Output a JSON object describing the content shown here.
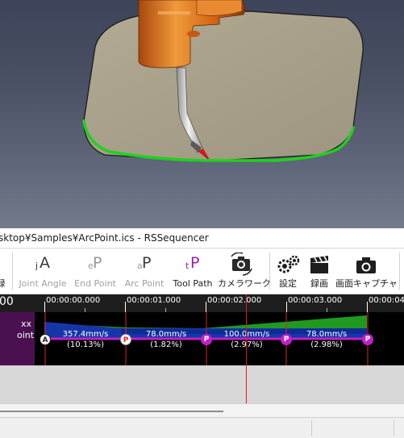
{
  "window": {
    "title": "sktop¥Samples¥ArcPoint.ics - RSSequencer"
  },
  "toolbar": {
    "left_cut_label": "録",
    "buttons": [
      {
        "id": "joint-angle",
        "prefix": "j",
        "glyph": "A",
        "label": "Joint Angle",
        "enabled": false,
        "icon": "joint-angle-icon"
      },
      {
        "id": "end-point",
        "prefix": "e",
        "glyph": "P",
        "label": "End Point",
        "enabled": false,
        "icon": "end-point-icon"
      },
      {
        "id": "arc-point",
        "prefix": "a",
        "glyph": "P",
        "label": "Arc Point",
        "enabled": false,
        "icon": "arc-point-icon"
      },
      {
        "id": "tool-path",
        "prefix": "t",
        "glyph": "P",
        "label": "Tool Path",
        "enabled": true,
        "icon": "tool-path-icon"
      },
      {
        "id": "camera-work",
        "label": "カメラワーク",
        "enabled": true,
        "icon": "camera-work-icon"
      },
      {
        "id": "settings",
        "label": "設定",
        "enabled": true,
        "icon": "gears-icon"
      },
      {
        "id": "record",
        "label": "録画",
        "enabled": true,
        "icon": "clapperboard-icon"
      },
      {
        "id": "screen-capture",
        "label": "画面キャプチャ",
        "enabled": true,
        "icon": "camera-icon"
      }
    ]
  },
  "timeline": {
    "ruler_left_cut": "00",
    "ruler_labels": [
      "00:00:00.000",
      "00:00:01.000",
      "00:00:02.000",
      "00:00:03.000",
      "00:00:04."
    ],
    "track_label_line1": "xx",
    "track_label_line2": "oint",
    "markers": [
      {
        "letter": "A",
        "style": "white-dark"
      },
      {
        "letter": "P",
        "style": "white-red"
      },
      {
        "letter": "P",
        "style": "magenta"
      },
      {
        "letter": "P",
        "style": "magenta"
      },
      {
        "letter": "P",
        "style": "magenta"
      }
    ],
    "segments": [
      {
        "speed": "357.4mm/s",
        "percent": "(10.13%)"
      },
      {
        "speed": "78.0mm/s",
        "percent": "(1.82%)"
      },
      {
        "speed": "100.0mm/s",
        "percent": "(2.97%)"
      },
      {
        "speed": "78.0mm/s",
        "percent": "(2.98%)"
      }
    ]
  },
  "colors": {
    "path_green": "#1fd11f",
    "plate": "#a79e86",
    "robot_orange": "#e0731f",
    "track_label_bg": "#4b1050",
    "marker_magenta": "#c21fc8",
    "playhead": "#e21b1b"
  }
}
